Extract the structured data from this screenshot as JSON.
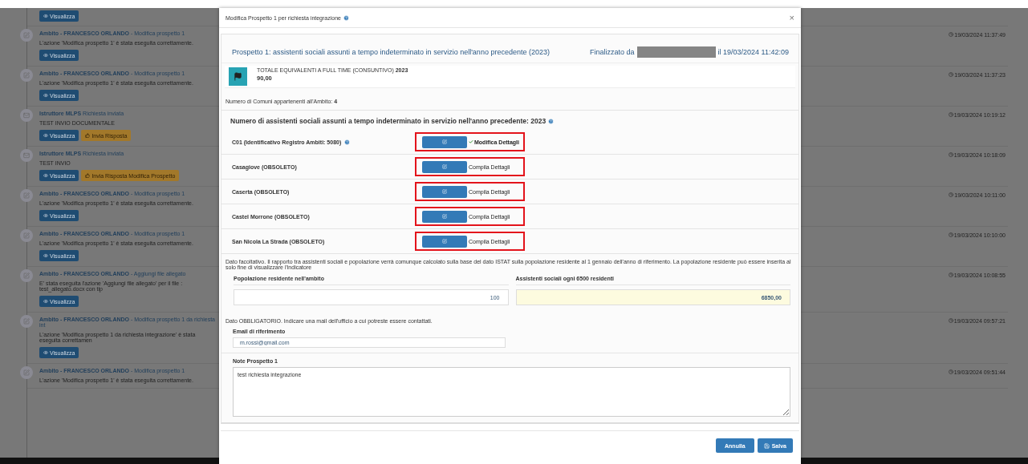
{
  "timeline": {
    "entries": [
      {
        "kind": "partial",
        "buttons": [
          {
            "label": "Visualizza",
            "kind": "primary"
          }
        ]
      },
      {
        "kind": "edit",
        "actor": "Ambito - FRANCESCO ORLANDO",
        "action": " - Modifica prospetto 1",
        "message": "L'azione 'Modifica prospetto 1' è stata eseguita correttamente.",
        "time": "19/03/2024 11:37:49",
        "buttons": [
          {
            "label": "Visualizza",
            "kind": "primary"
          }
        ]
      },
      {
        "kind": "edit",
        "actor": "Ambito - FRANCESCO ORLANDO",
        "action": " - Modifica prospetto 1",
        "message": "L'azione 'Modifica prospetto 1' è stata eseguita correttamente.",
        "time": "19/03/2024 11:37:23",
        "buttons": [
          {
            "label": "Visualizza",
            "kind": "primary"
          }
        ]
      },
      {
        "kind": "mail",
        "actor": "Istruttore MLPS",
        "action": " Richiesta inviata",
        "message": "TEST INVIO DOCUMENTALE",
        "time": "19/03/2024 10:19:12",
        "buttons": [
          {
            "label": "Visualizza",
            "kind": "primary"
          },
          {
            "label": "Invia Risposta",
            "kind": "warning"
          }
        ]
      },
      {
        "kind": "mail",
        "actor": "Istruttore MLPS",
        "action": " Richiesta inviata",
        "message": "TEST INVIO",
        "time": "19/03/2024 10:18:09",
        "buttons": [
          {
            "label": "Visualizza",
            "kind": "primary"
          },
          {
            "label": "Invia Risposta Modifica Prospetto",
            "kind": "warning"
          }
        ]
      },
      {
        "kind": "edit",
        "actor": "Ambito - FRANCESCO ORLANDO",
        "action": " - Modifica prospetto 1",
        "message": "L'azione 'Modifica prospetto 1' è stata eseguita correttamente.",
        "time": "19/03/2024 10:11:00",
        "buttons": [
          {
            "label": "Visualizza",
            "kind": "primary"
          }
        ]
      },
      {
        "kind": "edit",
        "actor": "Ambito - FRANCESCO ORLANDO",
        "action": " - Modifica prospetto 1",
        "message": "L'azione 'Modifica prospetto 1' è stata eseguita correttamente.",
        "time": "19/03/2024 10:10:00",
        "buttons": [
          {
            "label": "Visualizza",
            "kind": "primary"
          }
        ]
      },
      {
        "kind": "edit",
        "actor": "Ambito - FRANCESCO ORLANDO",
        "action": " - Aggiungi file allegato",
        "message": "E' stata eseguita l'azione 'Aggiungi file allegato' per il file : test_allegato.docx con tip",
        "time": "19/03/2024 10:08:55",
        "buttons": [
          {
            "label": "Visualizza",
            "kind": "primary"
          }
        ]
      },
      {
        "kind": "edit",
        "actor": "Ambito - FRANCESCO ORLANDO",
        "action": " - Modifica prospetto 1 da richiesta int",
        "message": "L'azione 'Modifica prospetto 1 da richiesta integrazione' è stata eseguita correttamen",
        "time": "19/03/2024 09:57:21",
        "buttons": [
          {
            "label": "Visualizza",
            "kind": "primary"
          }
        ]
      },
      {
        "kind": "edit",
        "actor": "Ambito - FRANCESCO ORLANDO",
        "action": " - Modifica prospetto 1",
        "message": "L'azione 'Modifica prospetto 1' è stata eseguita correttamente.",
        "time": "19/03/2024 09:51:44"
      }
    ]
  },
  "modal": {
    "title": "Modifica Prospetto 1 per richiesta integrazione",
    "close": "×",
    "prospetto": {
      "title": "Prospetto 1: assistenti sociali assunti a tempo indeterminato in servizio nell'anno precedente (2023)",
      "finalized_label": "Finalizzato da",
      "finalized_date": "il 19/03/2024 11:42:09"
    },
    "total": {
      "label": "TOTALE EQUIVALENTI A FULL TIME (CONSUNTIVO) **2023**",
      "value": "90,00"
    },
    "comuni": "Numero di Comuni appartenenti all'Ambito: **4**",
    "section_title": "Numero di assistenti sociali assunti a tempo indeterminato in servizio nell'anno precedente: 2023",
    "rows": [
      {
        "label": "C01 (Identificativo Registro Ambiti: 5080)",
        "help": true,
        "completed": true,
        "action": "Modifica Dettagli",
        "highlighted": true
      },
      {
        "label": "Casagiove (OBSOLETO)",
        "help": false,
        "completed": false,
        "action": "Compila Dettagli",
        "highlighted": true
      },
      {
        "label": "Caserta (OBSOLETO)",
        "help": false,
        "completed": false,
        "action": "Compila Dettagli",
        "highlighted": true
      },
      {
        "label": "Castel Morrone (OBSOLETO)",
        "help": false,
        "completed": false,
        "action": "Compila Dettagli",
        "highlighted": true
      },
      {
        "label": "San Nicola La Strada (OBSOLETO)",
        "help": false,
        "completed": false,
        "action": "Compila Dettagli",
        "highlighted": true
      }
    ],
    "optional_note": "Dato facoltativo. Il rapporto tra assistenti sociali e popolazione verrà comunque calcolato sulla base del dato ISTAT sulla popolazione residente al 1 gennaio dell'anno di riferimento. La popolazione residente può essere inserita al solo fine di visualizzare l'indicatore",
    "population": {
      "label": "Popolazione residente nell'ambito",
      "value": "100"
    },
    "ratio": {
      "label": "Assistenti sociali ogni 6500 residenti",
      "value": "6850,00"
    },
    "mandatory_note": "Dato OBBLIGATORIO. Indicare una mail dell'ufficio a cui potreste essere contattati.",
    "email": {
      "label": "Email di riferimento",
      "value": "m.rossi@gmail.com"
    },
    "notes": {
      "label": "Note Prospetto 1",
      "value": "test richiesta integrazione"
    },
    "buttons": [
      {
        "label": "Annulla",
        "kind": "cancel"
      },
      {
        "label": "Salva",
        "kind": "save"
      }
    ]
  }
}
